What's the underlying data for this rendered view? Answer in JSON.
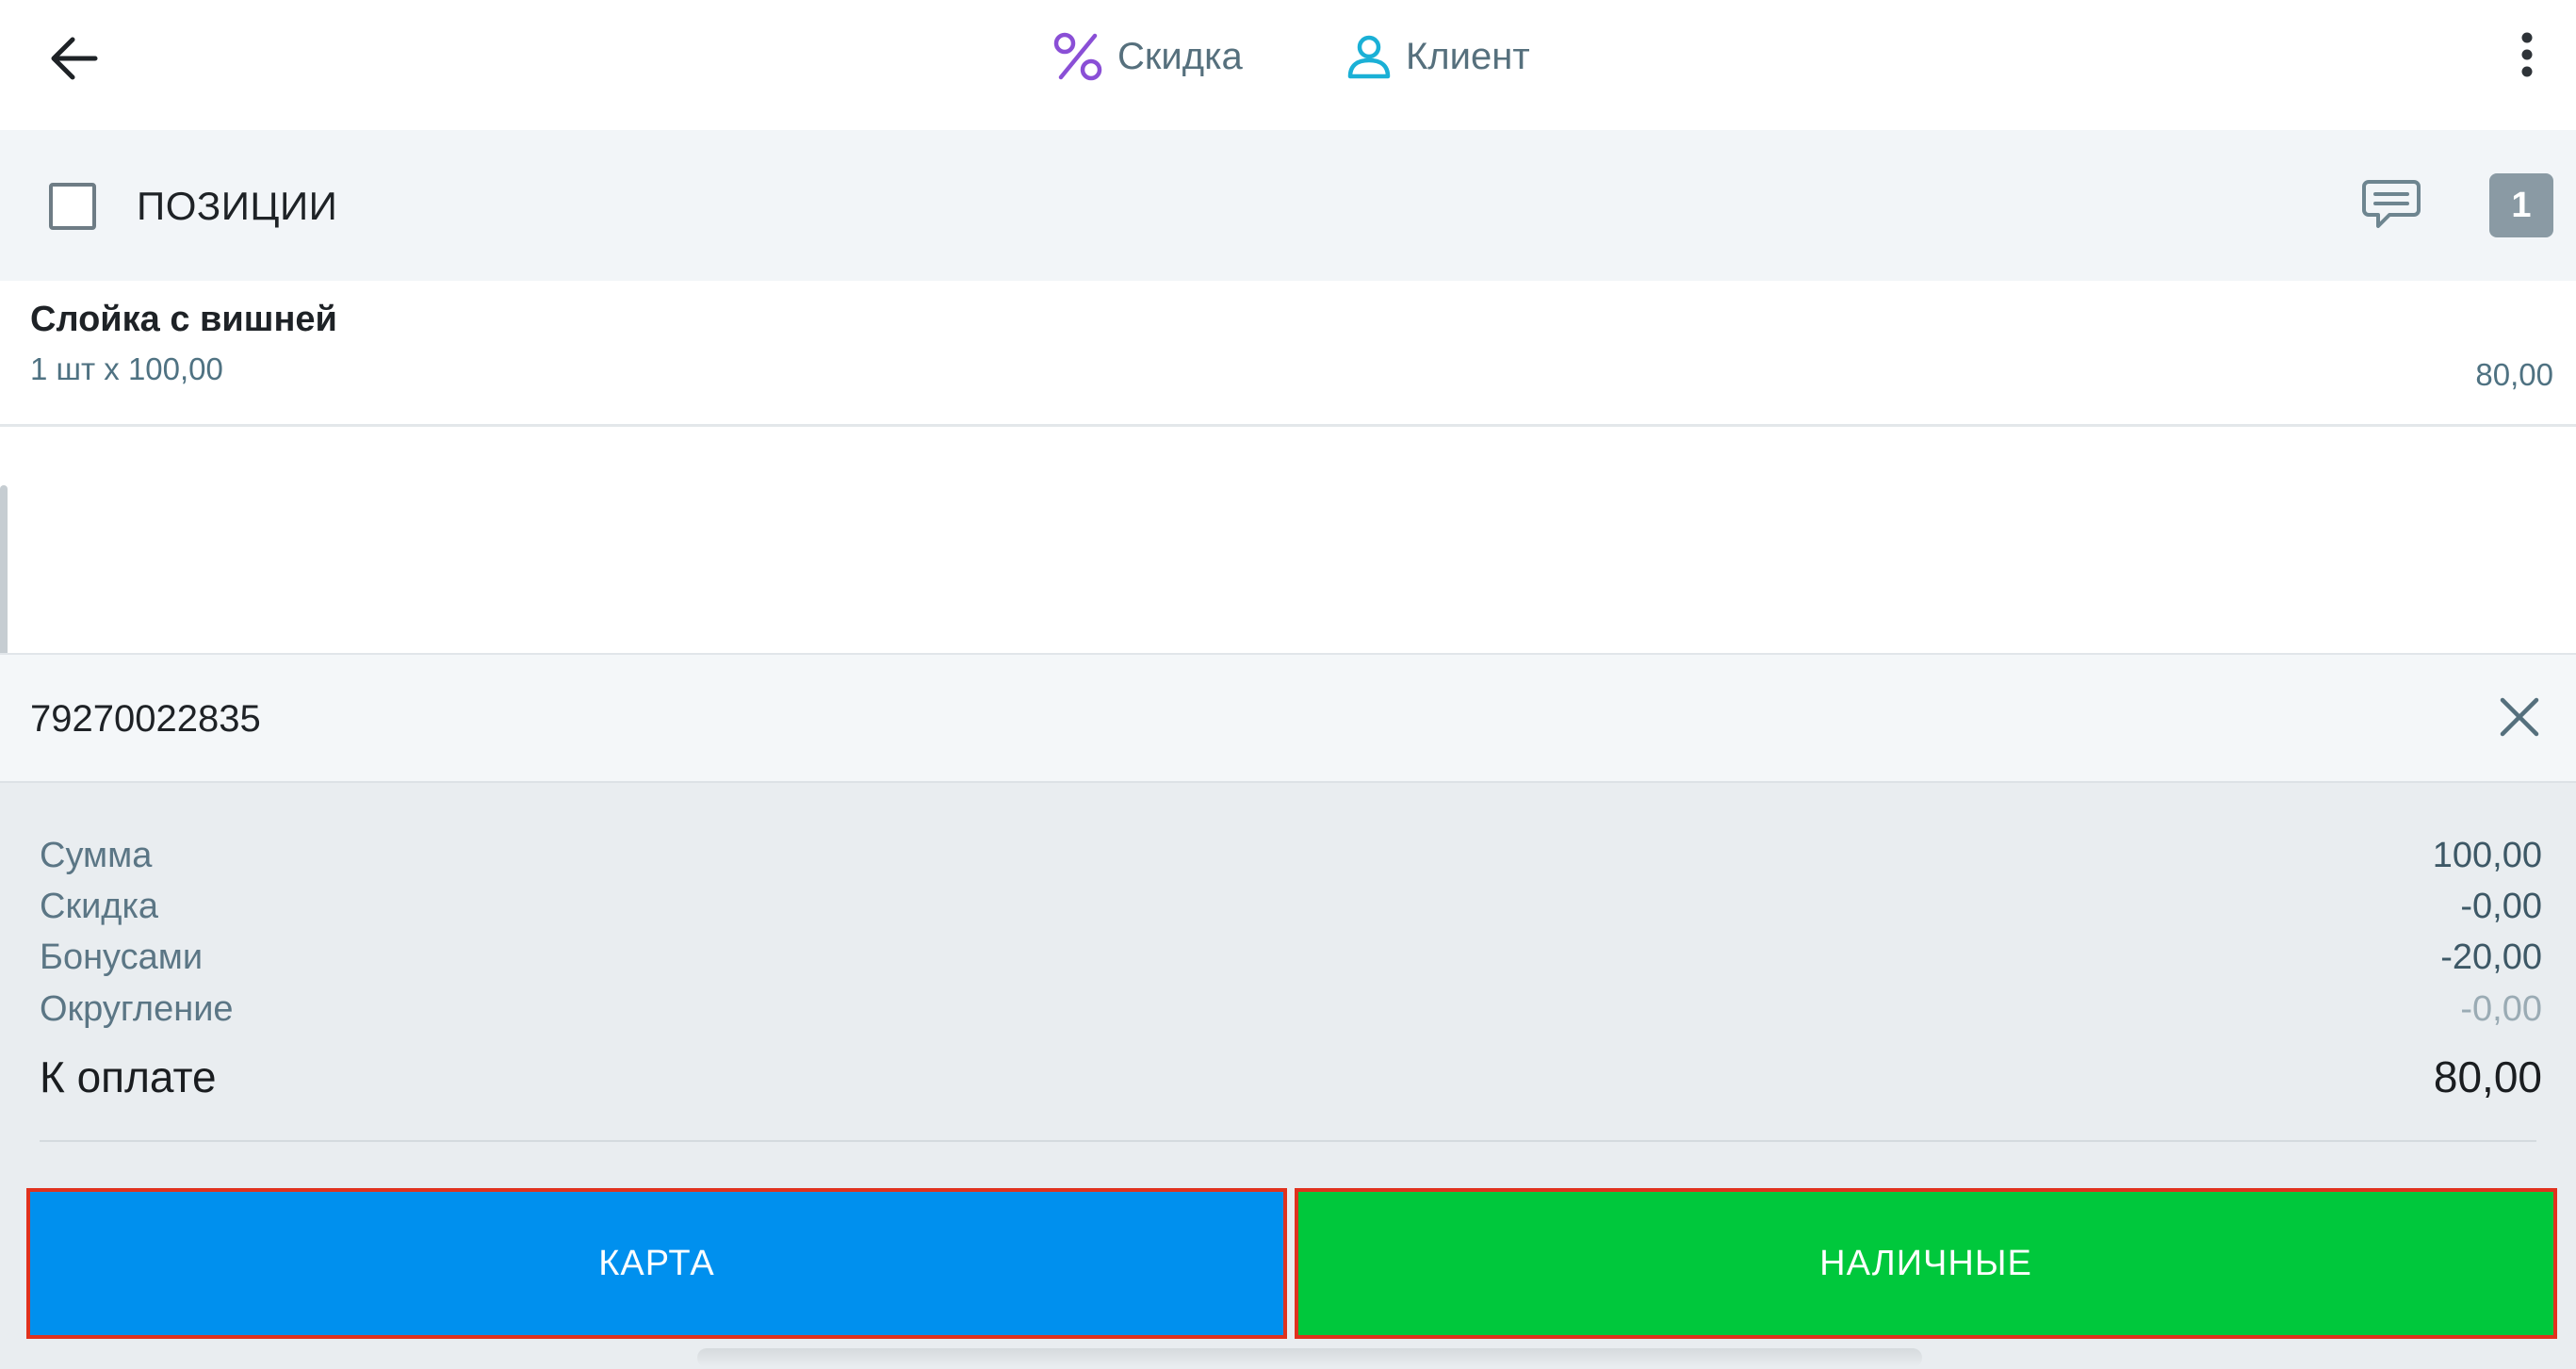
{
  "topbar": {
    "discount_label": "Скидка",
    "client_label": "Клиент",
    "icons": {
      "back": "arrow-left-icon",
      "discount": "percent-icon",
      "client": "person-icon",
      "more": "more-vertical-icon"
    },
    "colors": {
      "discount_icon": "#8a4fd6",
      "client_icon": "#1ab0d6"
    }
  },
  "positions": {
    "title": "ПОЗИЦИИ",
    "count": "1",
    "items": [
      {
        "name": "Слойка с вишней",
        "qty_price": "1 шт х 100,00",
        "total": "80,00"
      }
    ]
  },
  "client": {
    "phone": "79270022835"
  },
  "summary": {
    "lines": [
      {
        "label": "Сумма",
        "value": "100,00"
      },
      {
        "label": "Скидка",
        "value": "-0,00"
      },
      {
        "label": "Бонусами",
        "value": "-20,00"
      },
      {
        "label": "Округление",
        "value": "-0,00"
      }
    ],
    "total_label": "К оплате",
    "total_value": "80,00"
  },
  "payment": {
    "card_label": "КАРТА",
    "cash_label": "НАЛИЧНЫЕ",
    "colors": {
      "card": "#0090ee",
      "cash": "#00c83c",
      "highlight_border": "#e0321e"
    }
  }
}
